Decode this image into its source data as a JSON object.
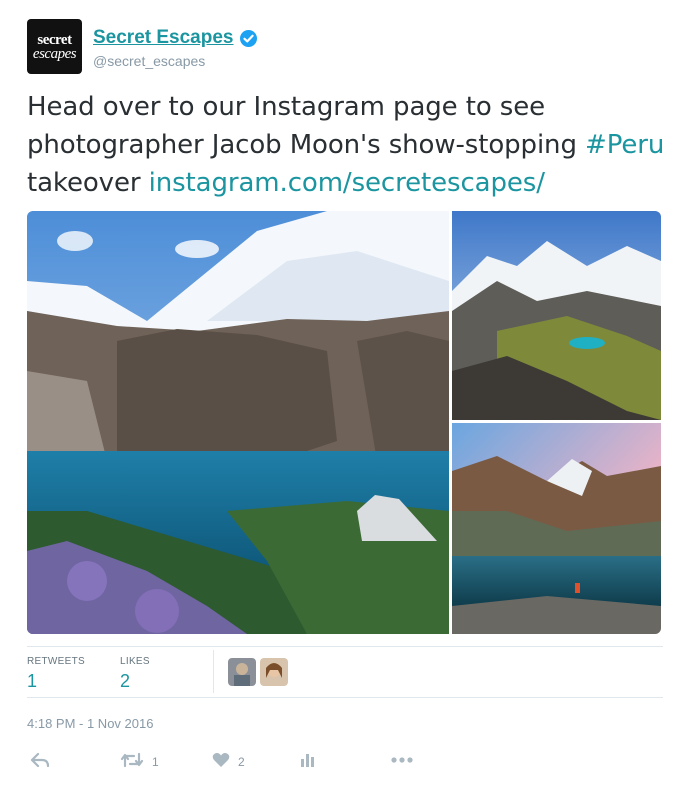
{
  "account": {
    "avatar_line1": "secret",
    "avatar_line2": "escapes",
    "name": "Secret Escapes",
    "handle": "@secret_escapes"
  },
  "tweet": {
    "text_part1": "Head over to our Instagram page to see photographer Jacob Moon's show-stopping ",
    "hashtag": "#Peru",
    "text_part2": " takeover ",
    "link": "instagram.com/secretescapes/"
  },
  "stats": {
    "retweets_label": "RETWEETS",
    "retweets_count": "1",
    "likes_label": "LIKES",
    "likes_count": "2"
  },
  "timestamp": "4:18 PM - 1 Nov 2016",
  "actions": {
    "reply_icon": "reply-icon",
    "retweet_icon": "retweet-icon",
    "retweet_count": "1",
    "like_icon": "heart-icon",
    "like_count": "2",
    "analytics_icon": "analytics-icon",
    "more_icon": "more-icon"
  },
  "colors": {
    "link": "#1b95a0",
    "muted": "#8899a6",
    "verified": "#1da1f2"
  }
}
